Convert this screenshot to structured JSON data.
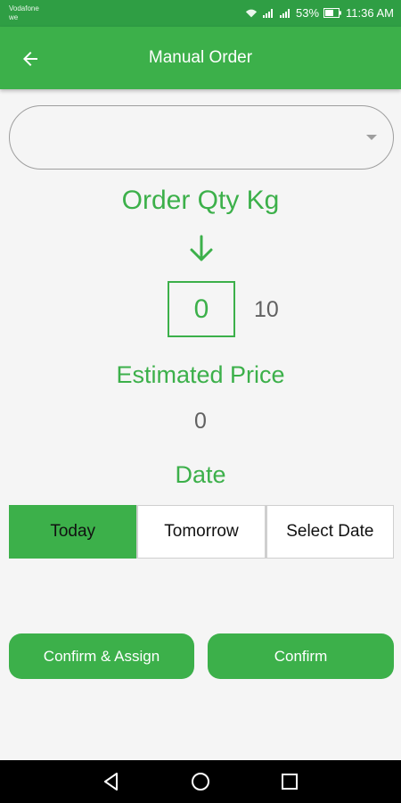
{
  "status_bar": {
    "carrier_line1": "Vodafone",
    "carrier_line2": "we",
    "battery": "53%",
    "time": "11:36 AM"
  },
  "toolbar": {
    "title": "Manual Order",
    "back_icon": "arrow-left-icon"
  },
  "dropdown": {
    "value": "",
    "icon": "caret-down-icon"
  },
  "order": {
    "qty_heading": "Order Qty Kg",
    "qty_value": "0",
    "qty_max": "10",
    "price_heading": "Estimated Price",
    "price_value": "0",
    "date_heading": "Date"
  },
  "date_tabs": [
    {
      "label": "Today",
      "active": true
    },
    {
      "label": "Tomorrow",
      "active": false
    },
    {
      "label": "Select Date",
      "active": false
    }
  ],
  "actions": {
    "confirm_assign": "Confirm & Assign",
    "confirm": "Confirm"
  },
  "colors": {
    "primary": "#3cb04a",
    "status_bar": "#2f9e44",
    "text_muted": "#616161"
  }
}
